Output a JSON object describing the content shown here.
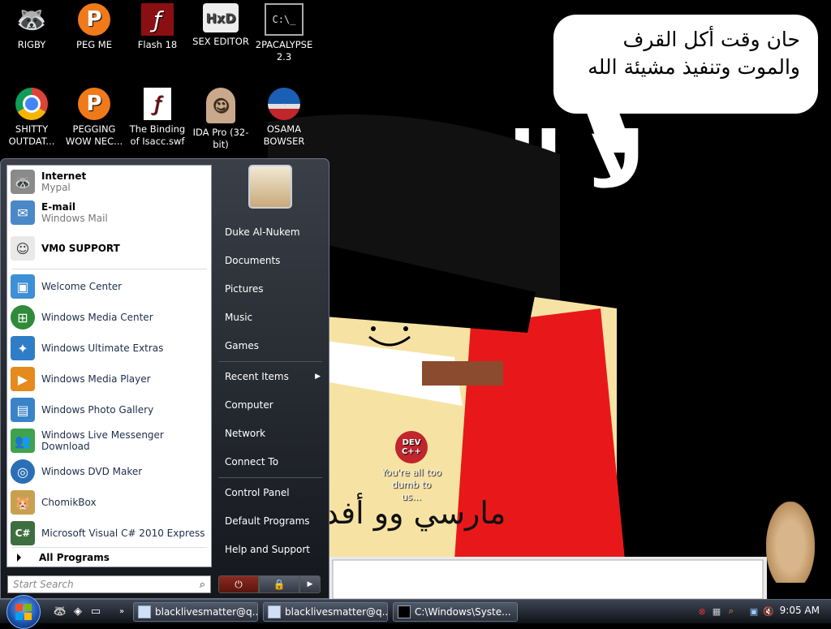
{
  "desktop": {
    "icons": [
      {
        "label": "RIGBY",
        "glyph": "🦝"
      },
      {
        "label": "PEG ME",
        "glyph": "P"
      },
      {
        "label": "Flash 18",
        "glyph": "ƒ"
      },
      {
        "label": "SEX EDITOR",
        "glyph": "HxD"
      },
      {
        "label": "2PACALYPSE 2.3",
        "glyph": "C:\\_"
      },
      {
        "label": "SHITTY OUTDAT...",
        "glyph": "◉"
      },
      {
        "label": "PEGGING WOW NEC...",
        "glyph": "P"
      },
      {
        "label": "The Binding of Isacc.swf",
        "glyph": "ƒ"
      },
      {
        "label": "IDA Pro (32-bit)",
        "glyph": "☺"
      },
      {
        "label": "OSAMA BOWSER",
        "glyph": "O"
      },
      {
        "label": "You're all too dumb to us...",
        "glyph": "DEV C++"
      }
    ],
    "speech_bubble": {
      "line1": "حان وقت أكل القرف",
      "line2": "والموت وتنفيذ مشيئة الله"
    },
    "wall_text_bottom": "مارسي وو أفد"
  },
  "start_menu": {
    "pinned": [
      {
        "title": "Internet",
        "subtitle": "Mypal",
        "icon": "raccoon-icon"
      },
      {
        "title": "E-mail",
        "subtitle": "Windows Mail",
        "icon": "mail-icon"
      },
      {
        "title": "VM0 SUPPORT",
        "subtitle": "",
        "icon": "support-icon"
      }
    ],
    "recent": [
      {
        "label": "Welcome Center",
        "icon": "welcome-icon",
        "color": "#3d8fd6"
      },
      {
        "label": "Windows Media Center",
        "icon": "media-center-icon",
        "color": "#2f8a3a"
      },
      {
        "label": "Windows Ultimate Extras",
        "icon": "extras-icon",
        "color": "#2f7dc6"
      },
      {
        "label": "Windows Media Player",
        "icon": "media-player-icon",
        "color": "#e58a1c"
      },
      {
        "label": "Windows Photo Gallery",
        "icon": "photo-gallery-icon",
        "color": "#3a83c9"
      },
      {
        "label": "Windows Live Messenger Download",
        "icon": "messenger-icon",
        "color": "#3fa34d"
      },
      {
        "label": "Windows DVD Maker",
        "icon": "dvd-icon",
        "color": "#2a6fb5"
      },
      {
        "label": "ChomikBox",
        "icon": "chomikbox-icon",
        "color": "#c8a050"
      },
      {
        "label": "Microsoft Visual C# 2010 Express",
        "icon": "csharp-icon",
        "color": "#3f6f3f"
      }
    ],
    "all_programs": "All Programs",
    "search_placeholder": "Start Search",
    "right": [
      {
        "label": "Duke Al-Nukem"
      },
      {
        "label": "Documents"
      },
      {
        "label": "Pictures"
      },
      {
        "label": "Music"
      },
      {
        "label": "Games"
      },
      {
        "label": "Recent Items"
      },
      {
        "label": "Computer"
      },
      {
        "label": "Network"
      },
      {
        "label": "Connect To"
      },
      {
        "label": "Control Panel"
      },
      {
        "label": "Default Programs"
      },
      {
        "label": "Help and Support"
      }
    ]
  },
  "taskbar": {
    "buttons": [
      {
        "label": "blacklivesmatter@q..."
      },
      {
        "label": "blacklivesmatter@q..."
      },
      {
        "label": "C:\\Windows\\Syste..."
      }
    ],
    "clock": "9:05 AM"
  }
}
